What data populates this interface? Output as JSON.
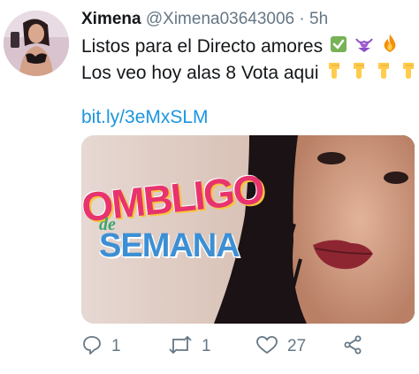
{
  "tweet": {
    "author_name": "Ximena",
    "handle": "@Ximena03643006",
    "separator": "·",
    "time": "5h",
    "line1": "Listos para el Directo amores",
    "line2": "Los veo hoy alas 8 Vota aqui",
    "link": "bit.ly/3eMxSLM"
  },
  "media": {
    "logo_word_1": "OMBLIGO",
    "logo_word_2": "de",
    "logo_word_3": "SEMANA"
  },
  "actions": {
    "reply_count": "1",
    "retweet_count": "1",
    "like_count": "27"
  },
  "icons": {
    "line1_emojis": [
      "check-mark-emoji",
      "bikini-emoji",
      "fire-emoji"
    ],
    "line2_emojis": [
      "pointing-down-emoji",
      "pointing-down-emoji",
      "pointing-down-emoji",
      "pointing-down-emoji"
    ],
    "actions": [
      "reply-icon",
      "retweet-icon",
      "like-icon",
      "share-icon"
    ]
  },
  "colors": {
    "link": "#1b95e0",
    "secondary_text": "#657786",
    "check_emoji": "#77b255",
    "logo_pink": "#e8336e",
    "logo_yellow": "#f5c53d",
    "logo_blue": "#3d8fd4"
  }
}
